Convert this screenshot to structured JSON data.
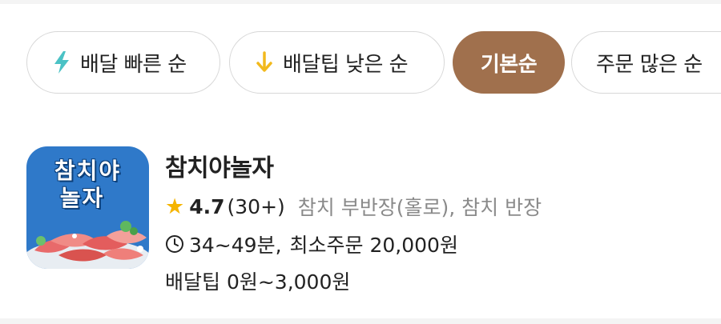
{
  "sort_chips": [
    {
      "label": "배달 빠른 순",
      "icon": "lightning-icon",
      "icon_color": "#4bc2c5",
      "active": false
    },
    {
      "label": "배달팁 낮은 순",
      "icon": "arrow-down-icon",
      "icon_color": "#f2b91d",
      "active": false
    },
    {
      "label": "기본순",
      "active": true,
      "active_color": "#a0704d"
    },
    {
      "label": "주문 많은 순",
      "active": false
    }
  ],
  "store": {
    "name": "참치야놀자",
    "thumbnail": {
      "line1": "참치야",
      "line2": "놀자",
      "background": "#2f79c9"
    },
    "rating": "4.7",
    "review_count": "(30+)",
    "menu": "참치 부반장(홀로), 참치 반장",
    "delivery_time": "34~49분,",
    "min_order": "최소주문 20,000원",
    "delivery_tip": "배달팁 0원~3,000원",
    "star_color": "#f5b400"
  }
}
